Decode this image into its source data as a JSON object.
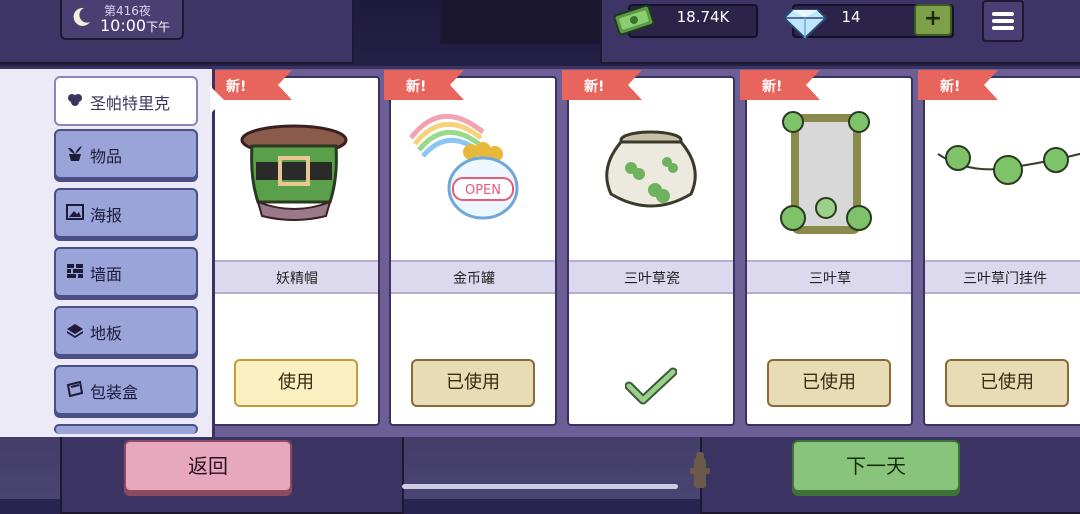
{
  "hud": {
    "night": "第416夜",
    "time": "10:00",
    "ampm": "下午",
    "money": "18.74K",
    "gems": "14",
    "plus": "+"
  },
  "categories": [
    {
      "label": "圣帕特里克",
      "icon": "clover-icon",
      "active": true
    },
    {
      "label": "物品",
      "icon": "plant-icon",
      "active": false
    },
    {
      "label": "海报",
      "icon": "picture-icon",
      "active": false
    },
    {
      "label": "墙面",
      "icon": "wall-icon",
      "active": false
    },
    {
      "label": "地板",
      "icon": "floor-icon",
      "active": false
    },
    {
      "label": "包装盒",
      "icon": "package-icon",
      "active": false
    }
  ],
  "items": [
    {
      "name": "妖精帽",
      "tag": "新!",
      "button": "使用",
      "state": "use",
      "image": "leprechaun-hat"
    },
    {
      "name": "金币罐",
      "tag": "新!",
      "button": "已使用",
      "state": "used",
      "image": "gold-pot-neon"
    },
    {
      "name": "三叶草瓷",
      "tag": "新!",
      "button": "",
      "state": "selected",
      "image": "clover-pot"
    },
    {
      "name": "三叶草",
      "tag": "新!",
      "button": "已使用",
      "state": "used",
      "image": "clover-mirror"
    },
    {
      "name": "三叶草门挂件",
      "tag": "新!",
      "button": "已使用",
      "state": "used",
      "image": "clover-garland"
    }
  ],
  "buttons": {
    "back": "返回",
    "next": "下一天"
  },
  "colors": {
    "tag": "#e8655e",
    "back": "#e7a8bd",
    "next": "#88c47c",
    "panel": "#6b5f96"
  }
}
